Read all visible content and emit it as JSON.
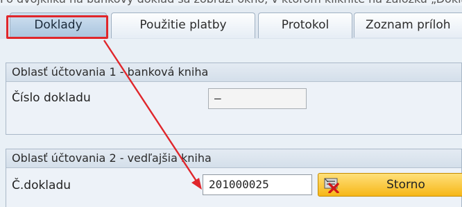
{
  "top_text": "Po dvojkliku na bankový doklad sa zobrazí okno, v ktorom kliknite na záložku „Doklady“.",
  "tabs": [
    {
      "label": "Doklady",
      "active": true
    },
    {
      "label": "Použitie platby",
      "active": false
    },
    {
      "label": "Protokol",
      "active": false
    },
    {
      "label": "Zoznam príloh",
      "active": false
    }
  ],
  "group1": {
    "title": "Oblasť účtovania 1 - banková kniha",
    "field_label": "Číslo dokladu",
    "field_value": "–"
  },
  "group2": {
    "title": "Oblasť účtovania 2 - vedľajšia kniha",
    "field_label": "Č.dokladu",
    "field_value": "201000025",
    "button_label": "Storno",
    "button_icon": "storno-icon"
  },
  "colors": {
    "highlight": "#e0262b",
    "arrow": "#e0262b",
    "button": "#f6b718"
  }
}
